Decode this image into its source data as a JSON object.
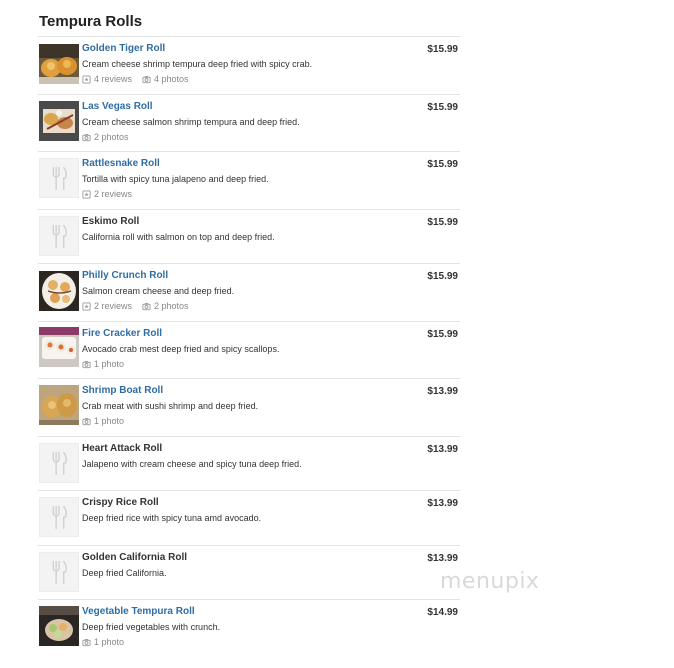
{
  "section": {
    "title": "Tempura Rolls"
  },
  "items": [
    {
      "name": "Golden Tiger Roll",
      "desc": "Cream cheese shrimp tempura deep fried with spicy crab.",
      "price": "$15.99",
      "reviews": "4 reviews",
      "photos": "4 photos",
      "linked": true,
      "thumb": "golden-tiger"
    },
    {
      "name": "Las Vegas Roll",
      "desc": "Cream cheese salmon shrimp tempura and deep fried.",
      "price": "$15.99",
      "reviews": "",
      "photos": "2 photos",
      "linked": true,
      "thumb": "las-vegas"
    },
    {
      "name": "Rattlesnake Roll",
      "desc": "Tortilla with spicy tuna jalapeno and deep fried.",
      "price": "$15.99",
      "reviews": "2 reviews",
      "photos": "",
      "linked": true,
      "thumb": "placeholder"
    },
    {
      "name": "Eskimo Roll",
      "desc": "California roll with salmon on top and deep fried.",
      "price": "$15.99",
      "reviews": "",
      "photos": "",
      "linked": false,
      "thumb": "placeholder"
    },
    {
      "name": "Philly Crunch Roll",
      "desc": "Salmon cream cheese and deep fried.",
      "price": "$15.99",
      "reviews": "2 reviews",
      "photos": "2 photos",
      "linked": true,
      "thumb": "philly"
    },
    {
      "name": "Fire Cracker Roll",
      "desc": "Avocado crab mest deep fried and spicy scallops.",
      "price": "$15.99",
      "reviews": "",
      "photos": "1 photo",
      "linked": true,
      "thumb": "fire-cracker"
    },
    {
      "name": "Shrimp Boat Roll",
      "desc": "Crab meat with sushi shrimp and deep fried.",
      "price": "$13.99",
      "reviews": "",
      "photos": "1 photo",
      "linked": true,
      "thumb": "shrimp-boat"
    },
    {
      "name": "Heart Attack Roll",
      "desc": "Jalapeno with cream cheese and spicy tuna deep fried.",
      "price": "$13.99",
      "reviews": "",
      "photos": "",
      "linked": false,
      "thumb": "placeholder"
    },
    {
      "name": "Crispy Rice Roll",
      "desc": "Deep fried rice with spicy tuna amd avocado.",
      "price": "$13.99",
      "reviews": "",
      "photos": "",
      "linked": false,
      "thumb": "placeholder"
    },
    {
      "name": "Golden California Roll",
      "desc": "Deep fried California.",
      "price": "$13.99",
      "reviews": "",
      "photos": "",
      "linked": false,
      "thumb": "placeholder"
    },
    {
      "name": "Vegetable Tempura Roll",
      "desc": "Deep fried vegetables with crunch.",
      "price": "$14.99",
      "reviews": "",
      "photos": "1 photo",
      "linked": true,
      "thumb": "vegetable"
    }
  ],
  "watermark": "menupix",
  "colors": {
    "link": "#2f6da3",
    "divider": "#e3e3e3",
    "meta": "#888888"
  }
}
